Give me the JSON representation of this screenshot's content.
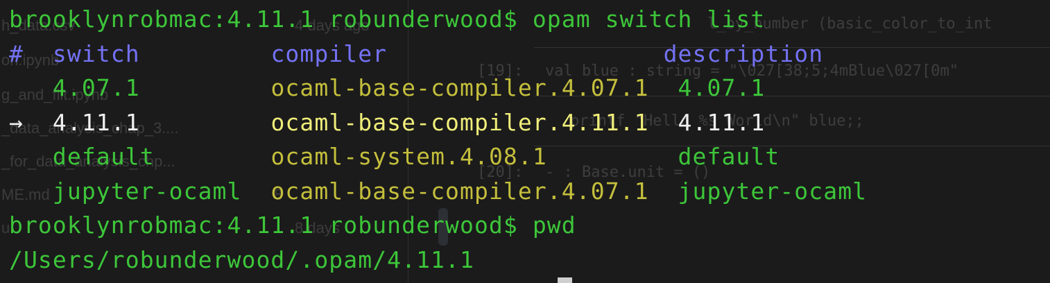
{
  "background_window": {
    "files": [
      {
        "name": "h_data.csv",
        "meta": "4 days ago"
      },
      {
        "name": "on.ipynb",
        "meta": ""
      },
      {
        "name": "g_and_filt.ipynb",
        "meta": ""
      },
      {
        "name": "_data_analysis_chap_3....",
        "meta": ""
      },
      {
        "name": "_for_data_analysis_chp...",
        "meta": ""
      },
      {
        "name": "ME.md",
        "meta": "8"
      },
      {
        "name": "u",
        "meta": "8 days"
      }
    ],
    "cell_label": "[19]:",
    "code_lines": [
      "l_by_number (basic_color_to_int",
      "val blue : string = \"\\027[38;5;4mBlue\\027[0m\"",
      "printf \"Hello %s World\\n\" blue;;",
      "- : Base.unit = ()"
    ],
    "cell_label_2": "[20]:"
  },
  "terminal": {
    "prompt_host": "brooklynrobmac:4.11.1 robunderwood$",
    "command_1": "opam switch list",
    "header": {
      "hash": "#",
      "switch": "switch",
      "compiler": "compiler",
      "description": "description"
    },
    "rows": [
      {
        "marker": "",
        "switch": "4.07.1",
        "compiler": "ocaml-base-compiler.4.07.1",
        "description": "4.07.1",
        "current": false
      },
      {
        "marker": "→",
        "switch": "4.11.1",
        "compiler": "ocaml-base-compiler.4.11.1",
        "description": "4.11.1",
        "current": true
      },
      {
        "marker": "",
        "switch": "default",
        "compiler": "ocaml-system.4.08.1",
        "description": "default",
        "current": false
      },
      {
        "marker": "",
        "switch": "jupyter-ocaml",
        "compiler": "ocaml-base-compiler.4.07.1",
        "description": "jupyter-ocaml",
        "current": false
      }
    ],
    "command_2": "pwd",
    "output": "/Users/robunderwood/.opam/4.11.1"
  },
  "colors": {
    "prompt": "#3dc63a",
    "header": "#7472f5",
    "compiler": "#c4bf3c",
    "current_compiler": "#f0ee7a",
    "current_text": "#f0f0f0",
    "background": "#1b1b1b"
  }
}
